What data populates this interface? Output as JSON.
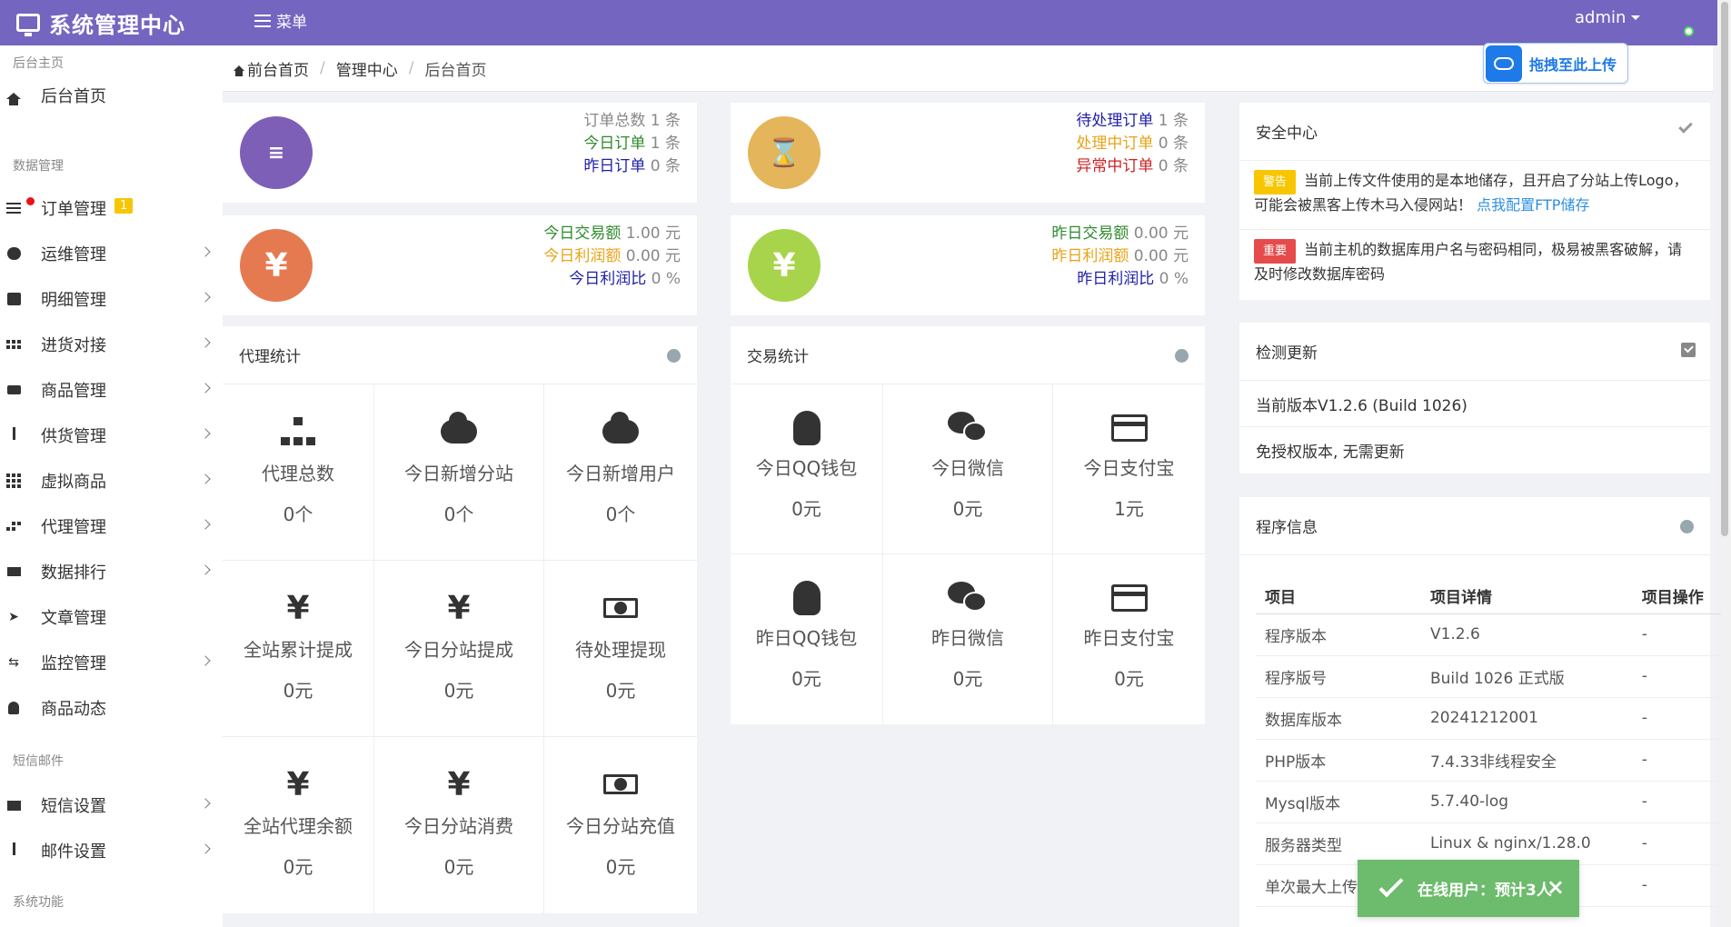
{
  "header": {
    "title": "系统管理中心",
    "menu_label": "菜单",
    "user": "admin"
  },
  "upload": {
    "label": "拖拽至此上传"
  },
  "sidebar": {
    "sections": [
      "后台主页",
      "数据管理",
      "短信邮件",
      "系统功能"
    ],
    "items": [
      {
        "label": "后台首页",
        "icon": "home-icon"
      },
      {
        "label": "订单管理",
        "icon": "list-icon",
        "badge": "1"
      },
      {
        "label": "运维管理",
        "icon": "comments-icon"
      },
      {
        "label": "明细管理",
        "icon": "calendar-icon"
      },
      {
        "label": "进货对接",
        "icon": "cubes-icon"
      },
      {
        "label": "商品管理",
        "icon": "cart-icon"
      },
      {
        "label": "供货管理",
        "icon": "cutlery-icon"
      },
      {
        "label": "虚拟商品",
        "icon": "grid-icon"
      },
      {
        "label": "代理管理",
        "icon": "sitemap-icon"
      },
      {
        "label": "数据排行",
        "icon": "flag-icon"
      },
      {
        "label": "文章管理",
        "icon": "paper-plane-icon"
      },
      {
        "label": "监控管理",
        "icon": "retweet-icon"
      },
      {
        "label": "商品动态",
        "icon": "bell-icon"
      },
      {
        "label": "短信设置",
        "icon": "industry-icon"
      },
      {
        "label": "邮件设置",
        "icon": "cutlery-icon"
      }
    ]
  },
  "breadcrumb": [
    "前台首页",
    "管理中心",
    "后台首页"
  ],
  "stats": {
    "orders": [
      {
        "label": "订单总数",
        "value": "1 条",
        "color": "#888888"
      },
      {
        "label": "今日订单",
        "value": "1 条",
        "color": "#2e8b2e"
      },
      {
        "label": "昨日订单",
        "value": "0 条",
        "color": "#1f1fa8"
      }
    ],
    "pending": [
      {
        "label": "待处理订单",
        "value": "1 条",
        "color": "#1f1fa8"
      },
      {
        "label": "处理中订单",
        "value": "0 条",
        "color": "#e8a317"
      },
      {
        "label": "异常中订单",
        "value": "0 条",
        "color": "#cc2222"
      }
    ],
    "today_trade": [
      {
        "label": "今日交易额",
        "value": "1.00 元",
        "color": "#2e8b2e"
      },
      {
        "label": "今日利润额",
        "value": "0.00 元",
        "color": "#e8a317"
      },
      {
        "label": "今日利润比",
        "value": "0 %",
        "color": "#1f1fa8"
      }
    ],
    "yesterday_trade": [
      {
        "label": "昨日交易额",
        "value": "0.00 元",
        "color": "#2e8b2e"
      },
      {
        "label": "昨日利润额",
        "value": "0.00 元",
        "color": "#e8a317"
      },
      {
        "label": "昨日利润比",
        "value": "0 %",
        "color": "#1f1fa8"
      }
    ]
  },
  "agent_stats": {
    "title": "代理统计",
    "cells": [
      {
        "label": "代理总数",
        "value": "0个",
        "icon": "sitemap-icon"
      },
      {
        "label": "今日新增分站",
        "value": "0个",
        "icon": "cloud-icon"
      },
      {
        "label": "今日新增用户",
        "value": "0个",
        "icon": "cloud-icon"
      },
      {
        "label": "全站累计提成",
        "value": "0元",
        "icon": "yen-icon"
      },
      {
        "label": "今日分站提成",
        "value": "0元",
        "icon": "yen-icon"
      },
      {
        "label": "待处理提现",
        "value": "0元",
        "icon": "money-icon"
      },
      {
        "label": "全站代理余额",
        "value": "0元",
        "icon": "yen-icon"
      },
      {
        "label": "今日分站消费",
        "value": "0元",
        "icon": "yen-icon"
      },
      {
        "label": "今日分站充值",
        "value": "0元",
        "icon": "money-icon"
      }
    ]
  },
  "trade_stats": {
    "title": "交易统计",
    "cells": [
      {
        "label": "今日QQ钱包",
        "value": "0元",
        "icon": "qq-icon"
      },
      {
        "label": "今日微信",
        "value": "0元",
        "icon": "wechat-icon"
      },
      {
        "label": "今日支付宝",
        "value": "1元",
        "icon": "credit-card-icon"
      },
      {
        "label": "昨日QQ钱包",
        "value": "0元",
        "icon": "qq-icon"
      },
      {
        "label": "昨日微信",
        "value": "0元",
        "icon": "wechat-icon"
      },
      {
        "label": "昨日支付宝",
        "value": "0元",
        "icon": "credit-card-icon"
      }
    ]
  },
  "security": {
    "title": "安全中心",
    "alerts": [
      {
        "tag": "警告",
        "text": "当前上传文件使用的是本地储存，且开启了分站上传Logo，可能会被黑客上传木马入侵网站！",
        "link": "点我配置FTP储存"
      },
      {
        "tag": "重要",
        "text": "当前主机的数据库用户名与密码相同，极易被黑客破解，请及时修改数据库密码"
      }
    ]
  },
  "update": {
    "title": "检测更新",
    "version": "当前版本V1.2.6 (Build 1026)",
    "note": "免授权版本, 无需更新"
  },
  "program": {
    "title": "程序信息",
    "headers": [
      "项目",
      "项目详情",
      "项目操作"
    ],
    "rows": [
      [
        "程序版本",
        "V1.2.6",
        "-"
      ],
      [
        "程序版号",
        "Build 1026 正式版",
        "-"
      ],
      [
        "数据库版本",
        "20241212001",
        "-"
      ],
      [
        "PHP版本",
        "7.4.33非线程安全",
        "-"
      ],
      [
        "Mysql版本",
        "5.7.40-log",
        "-"
      ],
      [
        "服务器类型",
        "Linux & nginx/1.28.0",
        "-"
      ],
      [
        "单次最大上传限制",
        "",
        "-"
      ]
    ]
  },
  "toast": {
    "text": "在线用户：预计3人",
    "close": "×"
  },
  "colors": {
    "header": "#7466c0",
    "purple": "#7d5fb8",
    "gold": "#e4b55b",
    "orange": "#e57a51",
    "lime": "#a8d44b",
    "toast": "#6dbb6d"
  }
}
